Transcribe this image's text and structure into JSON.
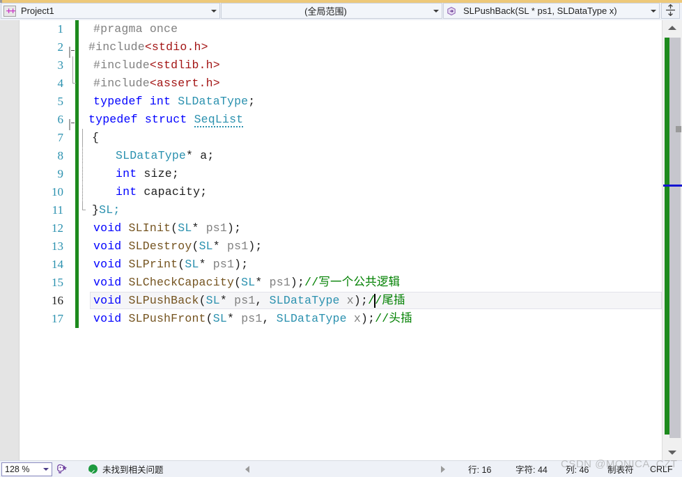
{
  "toolbar": {
    "project_combo": {
      "value": "Project1",
      "icon": "cpp-project-icon",
      "arrow_icon": "chevron-down-icon"
    },
    "scope_combo": {
      "value": "(全局范围)",
      "arrow_icon": "chevron-down-icon"
    },
    "member_combo": {
      "value": "SLPushBack(SL * ps1, SLDataType x)",
      "icon": "method-icon",
      "arrow_icon": "chevron-down-icon"
    },
    "split_button": {
      "icon": "split-window-icon",
      "label": ""
    }
  },
  "editor": {
    "lines": [
      {
        "n": "1",
        "text": "#pragma once"
      },
      {
        "n": "2",
        "text": "#include<stdio.h>"
      },
      {
        "n": "3",
        "text": "#include<stdlib.h>"
      },
      {
        "n": "4",
        "text": "#include<assert.h>"
      },
      {
        "n": "5",
        "text": "typedef int SLDataType;"
      },
      {
        "n": "6",
        "text": "typedef struct SeqList"
      },
      {
        "n": "7",
        "text": "{"
      },
      {
        "n": "8",
        "text": "    SLDataType* a;"
      },
      {
        "n": "9",
        "text": "    int size;"
      },
      {
        "n": "10",
        "text": "    int capacity;"
      },
      {
        "n": "11",
        "text": "}SL;"
      },
      {
        "n": "12",
        "text": "void SLInit(SL* ps1);"
      },
      {
        "n": "13",
        "text": "void SLDestroy(SL* ps1);"
      },
      {
        "n": "14",
        "text": "void SLPrint(SL* ps1);"
      },
      {
        "n": "15",
        "text": "void SLCheckCapacity(SL* ps1);//写一个公共逻辑"
      },
      {
        "n": "16",
        "text": "void SLPushBack(SL* ps1, SLDataType x);//尾插"
      },
      {
        "n": "17",
        "text": "void SLPushFront(SL* ps1, SLDataType x);//头插"
      }
    ],
    "tokens": {
      "pragma_once": "#pragma once",
      "include": "#include",
      "stdio": "<stdio.h>",
      "stdlib": "<stdlib.h>",
      "assert": "<assert.h>",
      "typedef": "typedef",
      "int": "int",
      "struct": "struct",
      "void": "void",
      "sldatatype": "SLDataType",
      "seqlist": "SeqList",
      "sl": "SL",
      "semi": ";",
      "open_brace": "{",
      "close_brace": "}",
      "star_a": "* a;",
      "size": " size;",
      "capacity": " capacity;",
      "sl_semi": "SL;",
      "fn_slinit": "SLInit",
      "fn_sldestroy": "SLDestroy",
      "fn_slprint": "SLPrint",
      "fn_slcheckcapacity": "SLCheckCapacity",
      "fn_slpushback": "SLPushBack",
      "fn_slpushfront": "SLPushFront",
      "args_ps1": "(",
      "star": "* ",
      "ps1": "ps1",
      "close_semi": ");",
      "comma_sp": ", ",
      "x": " x",
      "cmt_common": "//写一个公共逻辑",
      "cmt_tail": "//尾插",
      "cmt_head": "//头插"
    },
    "current_line": "16",
    "colors": {
      "keyword": "#0000FF",
      "type": "#2B91AF",
      "comment": "#008000",
      "preprocessor": "#808080",
      "string": "#A31515",
      "function": "#74531F",
      "changebar": "#1D8A1D",
      "caret_marker": "#1414D2",
      "accent": "#EDC87A"
    }
  },
  "scrollbar": {
    "up_icon": "scroll-up-arrow-icon",
    "down_icon": "scroll-down-arrow-icon"
  },
  "status_bar": {
    "zoom": "128 %",
    "zoom_arrow_icon": "chevron-down-icon",
    "intellicode_icon": "intellicode-icon",
    "error_icon": "check-circle-icon",
    "error_text": "未找到相关问题",
    "prev_icon": "nav-prev-arrow-icon",
    "next_icon": "nav-next-arrow-icon",
    "line_label": "行: 16",
    "char_label": "字符: 44",
    "col_label": "列: 46",
    "tab_label": "制表符",
    "eol_label": "CRLF"
  },
  "watermark": {
    "text": "CSDN @MONICA_CZT"
  }
}
